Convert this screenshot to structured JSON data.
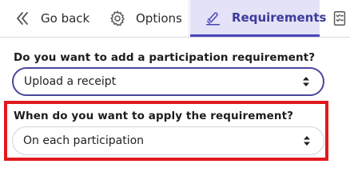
{
  "tabs": {
    "back_label": "Go back",
    "options_label": "Options",
    "requirements_label": "Requirements"
  },
  "form": {
    "q1": {
      "label": "Do you want to add a participation requirement?",
      "selected": "Upload a receipt"
    },
    "q2": {
      "label": "When do you want to apply the requirement?",
      "selected": "On each participation"
    }
  },
  "colors": {
    "accent": "#4a46b8",
    "active_tab_bg": "#e3e2f6",
    "highlight": "#e0191c"
  },
  "icons": {
    "back": "double-chevron-left-icon",
    "options": "gear-icon",
    "requirements": "stamp-icon",
    "more": "checklist-icon",
    "select_arrows": "up-down-arrows-icon"
  }
}
